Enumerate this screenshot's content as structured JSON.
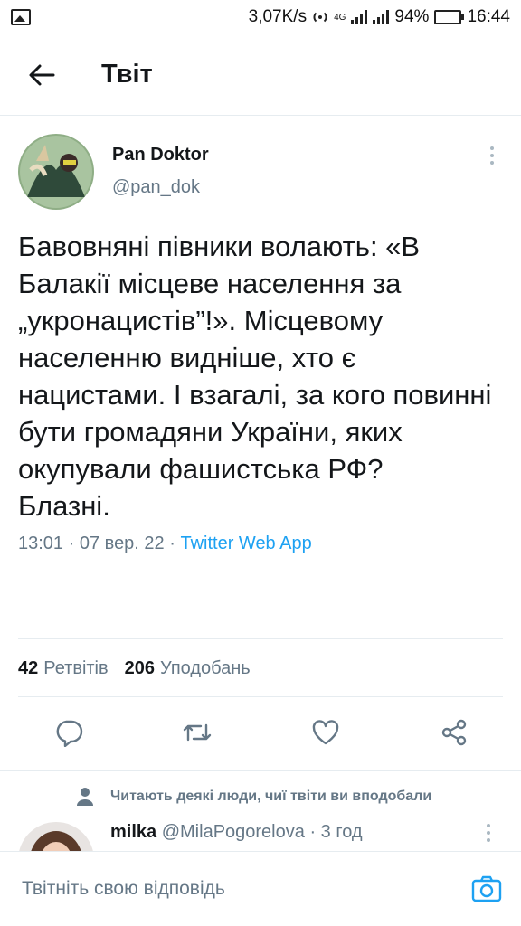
{
  "status_bar": {
    "speed": "3,07K/s",
    "network": "4G",
    "battery": "94%",
    "time": "16:44"
  },
  "header": {
    "title": "Твіт"
  },
  "tweet": {
    "author_name": "Pan Doktor",
    "author_handle": "@pan_dok",
    "text": "Бавовняні півники волають: «В Балакії місцеве населення за „укронацистів”!». Місцевому населенню видніше, хто є нацистами. І взагалі, за кого повинні бути громадяни України, яких окупували фашистська РФ?\nБлазні.",
    "time": "13:01",
    "date": "07 вер. 22",
    "source": "Twitter Web App",
    "separator": "·"
  },
  "stats": {
    "retweets_count": "42",
    "retweets_label": "Ретвітів",
    "likes_count": "206",
    "likes_label": "Уподобань"
  },
  "actions": {
    "icons": [
      "reply-icon",
      "retweet-icon",
      "like-icon",
      "share-icon"
    ]
  },
  "social_context": {
    "text": "Читають деякі люди, чиї твіти ви вподобали"
  },
  "reply": {
    "author_name": "milka",
    "author_handle": "@MilaPogorelova",
    "time": "3 год",
    "separator": "·"
  },
  "composer": {
    "placeholder": "Твітніть свою відповідь"
  },
  "colors": {
    "accent": "#1da1f2",
    "secondary_text": "#657786",
    "divider": "#e6ecf0"
  }
}
